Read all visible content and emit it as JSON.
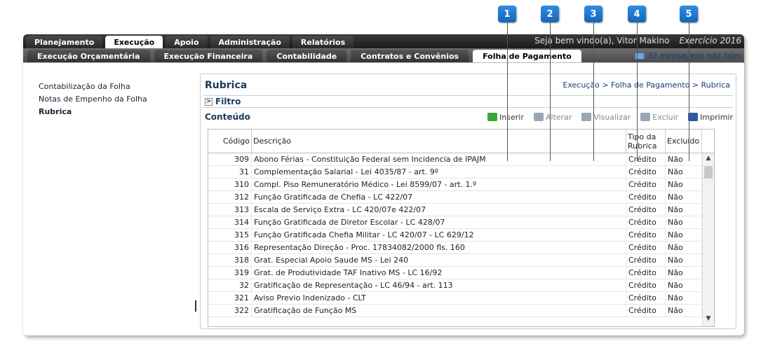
{
  "callouts": [
    "1",
    "2",
    "3",
    "4",
    "5"
  ],
  "top_tabs": [
    "Planejamento",
    "Execução",
    "Apoio",
    "Administração",
    "Relatórios"
  ],
  "welcome": "Seja bem vindo(a), Vitor Makino",
  "exercicio": "Exercício 2016",
  "sub_tabs": [
    "Execução Orçamentária",
    "Execução Financeira",
    "Contabilidade",
    "Contratos e Convênios",
    "Folha de Pagamento"
  ],
  "messages": "33 mensagens não lidas",
  "sidebar": [
    "Contabilização da Folha",
    "Notas de Empenho da Folha",
    "Rubrica"
  ],
  "page_title": "Rubrica",
  "breadcrumb": "Execução > Folha de Pagamento > Rubrica",
  "filter_label": "Filtro",
  "content_label": "Conteúdo",
  "toolbar": {
    "inserir": "Inserir",
    "alterar": "Alterar",
    "visualizar": "Visualizar",
    "excluir": "Excluir",
    "imprimir": "Imprimir"
  },
  "columns": {
    "codigo": "Código",
    "descricao": "Descrição",
    "tipo": "Tipo da Rubrica",
    "excluido": "Excluído"
  },
  "rows": [
    [
      "309",
      "Abono Férias - Constituição Federal sem Incidencia de IPAJM",
      "Crédito",
      "Não"
    ],
    [
      "31",
      "Complementação Salarial - Lei 4035/87 - art. 9º",
      "Crédito",
      "Não"
    ],
    [
      "310",
      "Compl. Piso Remuneratório Médico - Lei 8599/07 - art. 1.º",
      "Crédito",
      "Não"
    ],
    [
      "312",
      "Função Gratificada de Chefia - LC 422/07",
      "Crédito",
      "Não"
    ],
    [
      "313",
      "Escala de Serviço Extra - LC 420/07e 422/07",
      "Crédito",
      "Não"
    ],
    [
      "314",
      "Função Gratificada de Diretor Escolar - LC 428/07",
      "Crédito",
      "Não"
    ],
    [
      "315",
      "Função Gratificada Chefia Militar - LC 420/07 - LC 629/12",
      "Crédito",
      "Não"
    ],
    [
      "316",
      "Representação Direção - Proc. 17834082/2000 fls. 160",
      "Crédito",
      "Não"
    ],
    [
      "318",
      "Grat. Especial Apoio Saude MS - Lei 240",
      "Crédito",
      "Não"
    ],
    [
      "319",
      "Grat. de Produtividade TAF Inativo MS - LC 16/92",
      "Crédito",
      "Não"
    ],
    [
      "32",
      "Gratificação de Representação - LC 46/94 - art. 113",
      "Crédito",
      "Não"
    ],
    [
      "321",
      "Aviso Previo Indenizado - CLT",
      "Crédito",
      "Não"
    ],
    [
      "322",
      "Gratificação de Função MS",
      "Crédito",
      "Não"
    ]
  ],
  "colors": {
    "inserir": "#3aa63a",
    "disabled": "#9aa6b2",
    "imprimir": "#2a5aa0",
    "badge": "#1e78d0"
  }
}
